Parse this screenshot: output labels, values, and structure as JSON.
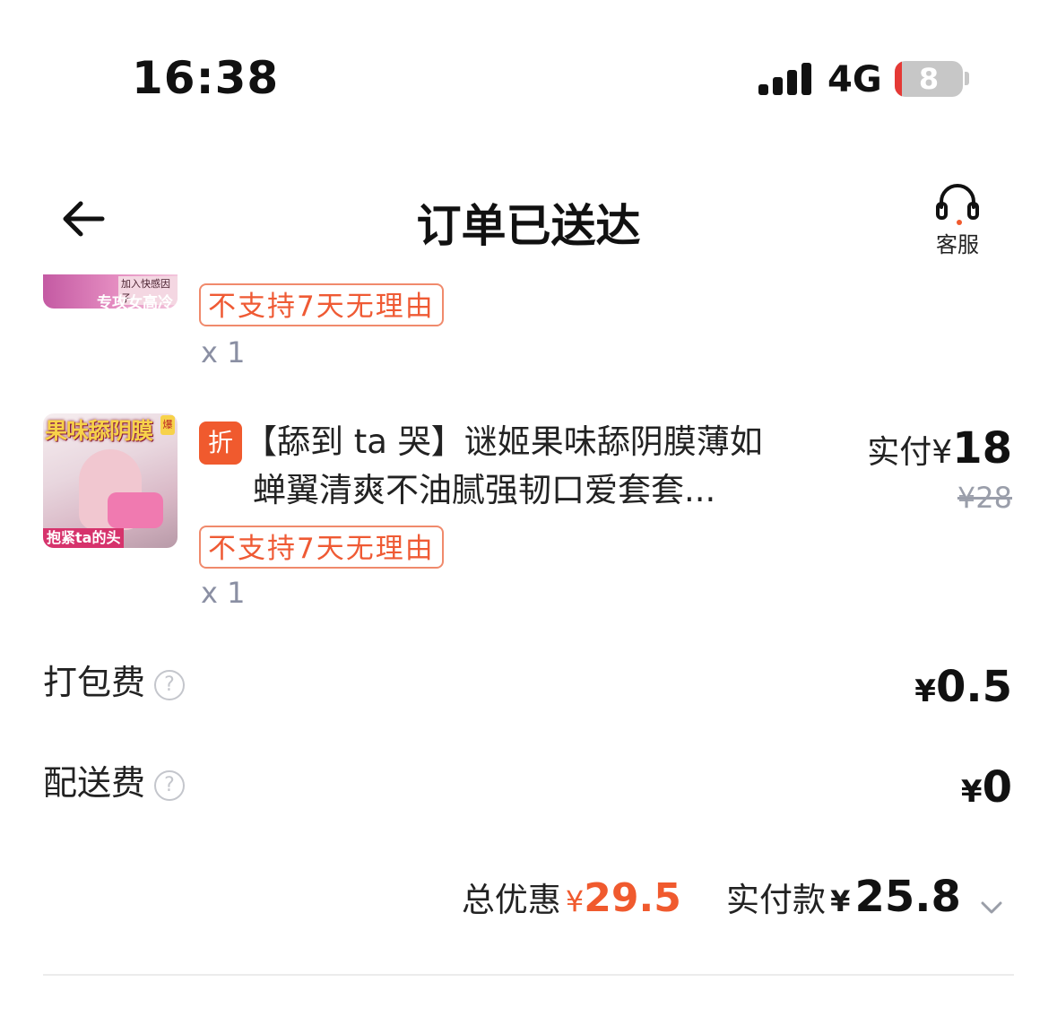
{
  "status_bar": {
    "time": "16:38",
    "network": "4G",
    "battery": "8",
    "battery_level": 0.08
  },
  "header": {
    "title": "订单已送达",
    "service_label": "客服",
    "back_icon": "back-arrow-icon",
    "service_icon": "headset-icon"
  },
  "items": [
    {
      "thumb_text_1": "加入快感因子",
      "thumb_text_2": "专攻女高冷",
      "tag": "不支持7天无理由",
      "qty": "x 1"
    },
    {
      "badge": "折",
      "name_line1": "【舔到 ta 哭】谜姬果味舔阴膜薄如",
      "name_line2": "蝉翼清爽不油腻强韧口爱套套...",
      "paid_label": "实付",
      "paid_currency": "¥",
      "paid_value": "18",
      "original_price": "¥28",
      "tag": "不支持7天无理由",
      "qty": "x 1",
      "thumb_title": "果味舔阴膜",
      "thumb_badge": "爆",
      "thumb_caption": "抱紧ta的头"
    }
  ],
  "fees": [
    {
      "label": "打包费",
      "currency": "¥",
      "value": "0.5",
      "help": "?"
    },
    {
      "label": "配送费",
      "currency": "¥",
      "value": "0",
      "help": "?"
    }
  ],
  "summary": {
    "discount_label": "总优惠",
    "discount_currency": "¥",
    "discount_value": "29.5",
    "paid_label": "实付款",
    "paid_currency": "¥",
    "paid_value": "25.8",
    "expand_icon": "chevron-down-icon"
  },
  "colors": {
    "accent": "#f05a2e",
    "tag_border": "#f08a6c",
    "muted": "#8a8fa3"
  }
}
